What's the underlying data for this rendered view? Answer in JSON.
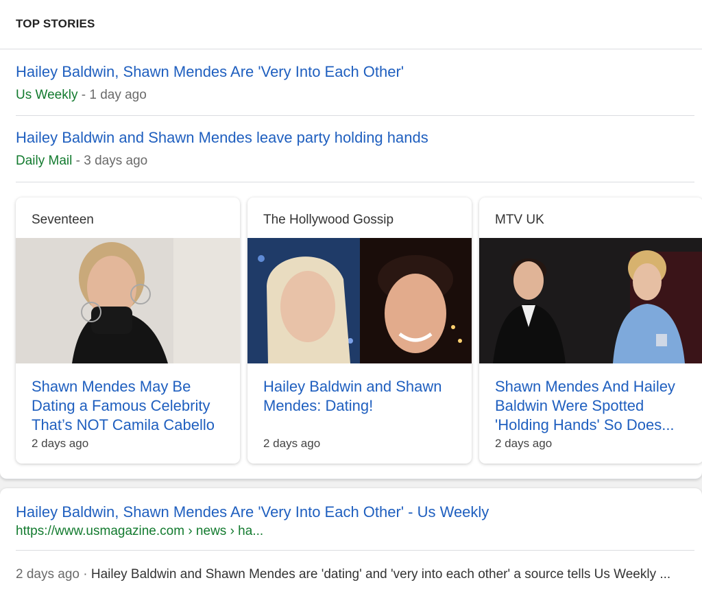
{
  "top_stories": {
    "title": "TOP STORIES",
    "stories": [
      {
        "headline": "Hailey Baldwin, Shawn Mendes Are 'Very Into Each Other'",
        "source": "Us Weekly",
        "separator": " - ",
        "time": "1 day ago"
      },
      {
        "headline": "Hailey Baldwin and Shawn Mendes leave party holding hands",
        "source": "Daily Mail",
        "separator": " - ",
        "time": "3 days ago"
      }
    ],
    "cards": [
      {
        "publisher": "Seventeen",
        "headline": "Shawn Mendes May Be Dating a Famous Celebrity That’s NOT Camila Cabello",
        "time": "2 days ago"
      },
      {
        "publisher": "The Hollywood Gossip",
        "headline": "Hailey Baldwin and Shawn Mendes: Dating!",
        "time": "2 days ago"
      },
      {
        "publisher": "MTV UK",
        "headline": "Shawn Mendes And Hailey Baldwin Were Spotted 'Holding Hands' So Does...",
        "time": "2 days ago"
      }
    ]
  },
  "result": {
    "headline": "Hailey Baldwin, Shawn Mendes Are 'Very Into Each Other' - Us Weekly",
    "url": "https://www.usmagazine.com › news › ha...",
    "date": "2 days ago",
    "separator": " · ",
    "snippet": "Hailey Baldwin and Shawn Mendes are 'dating' and 'very into each other' a source tells Us Weekly ..."
  },
  "colors": {
    "link": "#1f5fbf",
    "source_green": "#127a2e",
    "muted": "#6a6a6a"
  },
  "images": {
    "photo1": "portrait-photo",
    "photo2": "portrait-photo",
    "photo3": "event-photo"
  }
}
